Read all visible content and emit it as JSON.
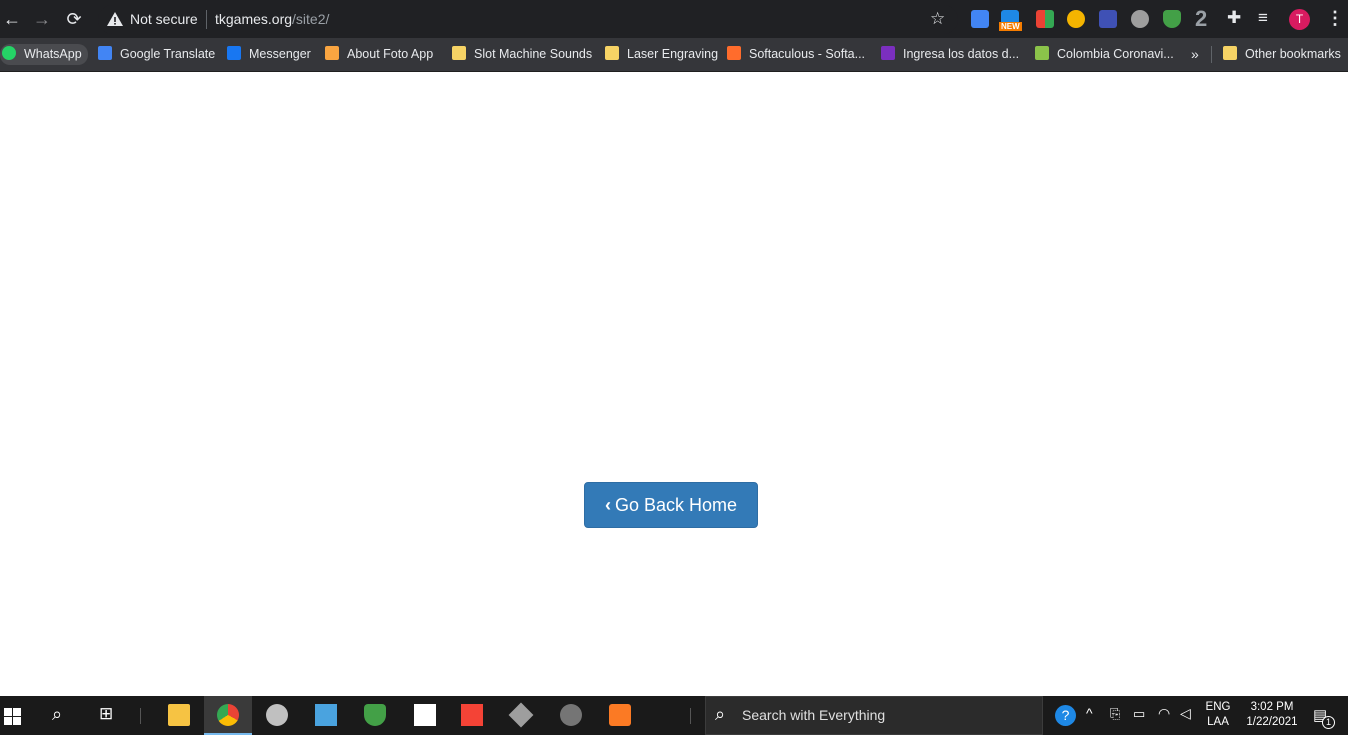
{
  "browser": {
    "security_label": "Not secure",
    "url_host": "tkgames.org",
    "url_path": "/site2/",
    "extension_badge": "NEW",
    "extension_count": "2",
    "profile_initial": "T"
  },
  "bookmarks": [
    {
      "label": "WhatsApp",
      "icon": "whatsapp-icon",
      "color": "#25d366"
    },
    {
      "label": "Google Translate",
      "icon": "google-translate-icon",
      "color": "#4285f4"
    },
    {
      "label": "Messenger",
      "icon": "facebook-icon",
      "color": "#1877f2"
    },
    {
      "label": "About Foto App",
      "icon": "joomla-icon",
      "color": "#f9a541"
    },
    {
      "label": "Slot Machine Sounds",
      "icon": "folder-icon",
      "color": "#f6d365"
    },
    {
      "label": "Laser Engraving",
      "icon": "folder-icon",
      "color": "#f6d365"
    },
    {
      "label": "Softaculous - Softa...",
      "icon": "softaculous-icon",
      "color": "#ff6c2c"
    },
    {
      "label": "Ingresa los datos d...",
      "icon": "flag-icon",
      "color": "#7b2fbf"
    },
    {
      "label": "Colombia Coronavi...",
      "icon": "u-icon",
      "color": "#8bc34a"
    },
    {
      "label": "Other bookmarks",
      "icon": "folder-icon",
      "color": "#f6d365"
    }
  ],
  "bookmarks_overflow": "»",
  "page": {
    "button_label": "Go Back Home"
  },
  "taskbar": {
    "search_placeholder": "Search with Everything",
    "language": "ENG",
    "language_sub": "LAA",
    "time": "3:02 PM",
    "date": "1/22/2021",
    "notification_count": "1"
  }
}
